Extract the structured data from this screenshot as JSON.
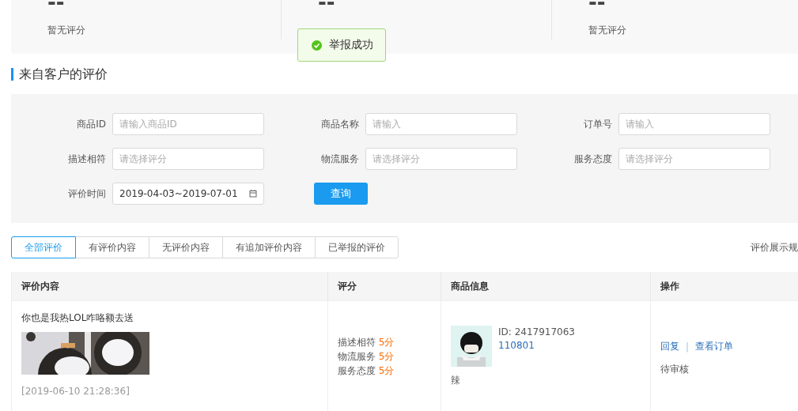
{
  "stats": [
    {
      "value": "--",
      "label": "暂无评分"
    },
    {
      "value": "--"
    },
    {
      "value": "--",
      "label": "暂无评分"
    }
  ],
  "toast": {
    "kind": "success",
    "text": "举报成功"
  },
  "section_title": "来自客户的评价",
  "filters": [
    {
      "label": "商品ID",
      "placeholder": "请输入商品ID"
    },
    {
      "label": "商品名称",
      "placeholder": "请输入"
    },
    {
      "label": "订单号",
      "placeholder": "请输入"
    },
    {
      "label": "描述相符",
      "placeholder": "请选择评分"
    },
    {
      "label": "物流服务",
      "placeholder": "请选择评分"
    },
    {
      "label": "服务态度",
      "placeholder": "请选择评分"
    },
    {
      "label": "评价时间",
      "value": "2019-04-03~2019-07-01"
    }
  ],
  "query_button": "查询",
  "tabs": [
    {
      "label": "全部评价",
      "selected": true
    },
    {
      "label": "有评价内容",
      "selected": false
    },
    {
      "label": "无评价内容",
      "selected": false
    },
    {
      "label": "有追加评价内容",
      "selected": false
    },
    {
      "label": "已举报的评价",
      "selected": false
    }
  ],
  "rules_link": "评价展示规",
  "table": {
    "columns": [
      "评价内容",
      "评分",
      "商品信息",
      "操作"
    ],
    "rows": [
      {
        "comment": "你也是我热LOL咋咯额去送",
        "photo": {
          "kind": "picture"
        },
        "time": "[2019-06-10 21:28:36]",
        "scores": [
          {
            "label": "描述相符",
            "value": "5分"
          },
          {
            "label": "物流服务",
            "value": "5分"
          },
          {
            "label": "服务态度",
            "value": "5分"
          }
        ],
        "product": {
          "id": "ID: 2417917063",
          "code": "110801",
          "name": "辣"
        },
        "actions": [
          "回复",
          "查看订单"
        ],
        "action_separator": "|",
        "status": "待审核"
      }
    ]
  }
}
